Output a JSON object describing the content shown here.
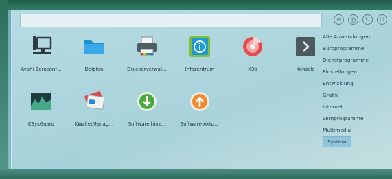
{
  "search": {
    "value": "",
    "placeholder": ""
  },
  "top_buttons": [
    {
      "icon": "settings-circle-icon",
      "glyph": "⊙"
    },
    {
      "icon": "user-circle-icon",
      "glyph": "@"
    },
    {
      "icon": "refresh-icon",
      "glyph": "↻"
    },
    {
      "icon": "power-icon",
      "glyph": "⏻"
    }
  ],
  "apps": [
    {
      "label": "Avahi Zeroconf…",
      "icon": "network-computer-icon"
    },
    {
      "label": "Dolphin",
      "icon": "folder-icon"
    },
    {
      "label": "Druckerverwal…",
      "icon": "printer-icon"
    },
    {
      "label": "Infozentrum",
      "icon": "info-icon"
    },
    {
      "label": "K3b",
      "icon": "disc-burner-icon"
    },
    {
      "label": "Konsole",
      "icon": "terminal-icon"
    },
    {
      "label": "KSysGuard",
      "icon": "system-monitor-icon"
    },
    {
      "label": "KWalletManag…",
      "icon": "wallet-icon"
    },
    {
      "label": "Software hinz…",
      "icon": "install-software-icon"
    },
    {
      "label": "Software-Aktu…",
      "icon": "software-update-icon"
    }
  ],
  "categories": [
    "Alle Anwendungen",
    "Büroprogramme",
    "Dienstprogramme",
    "Einstellungen",
    "Entwicklung",
    "Grafik",
    "Internet",
    "Lernprogramme",
    "Multimedia",
    "System"
  ],
  "selected_category": "System"
}
